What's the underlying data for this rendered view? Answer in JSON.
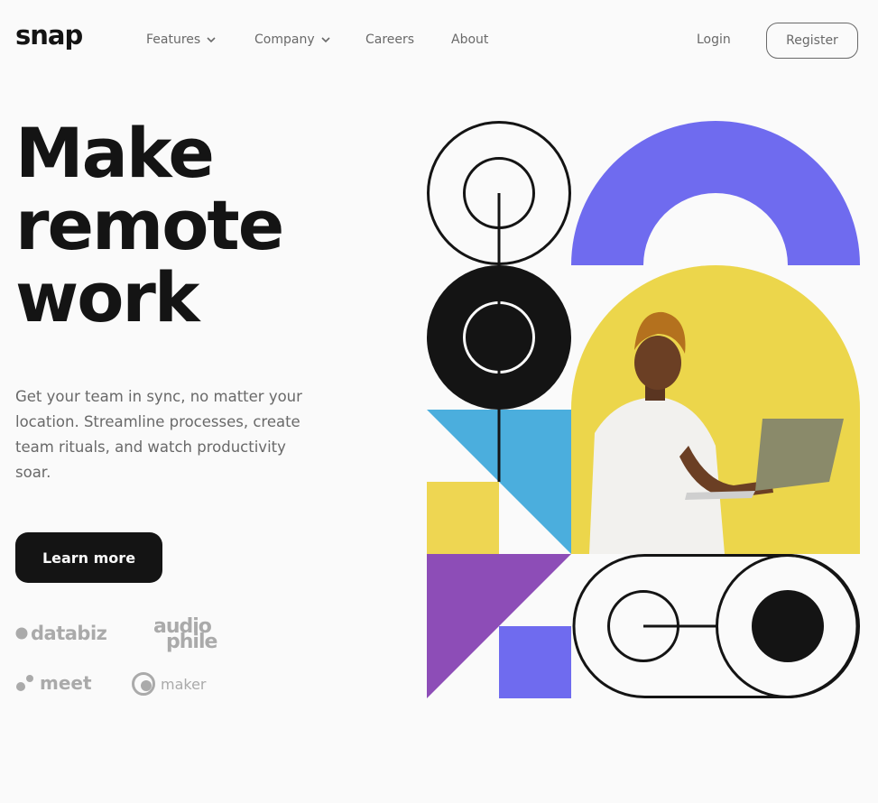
{
  "brand": {
    "logo": "snap"
  },
  "nav": {
    "features": "Features",
    "company": "Company",
    "careers": "Careers",
    "about": "About",
    "login": "Login",
    "register": "Register"
  },
  "hero": {
    "headline_lines": [
      "Make",
      "remote",
      "work"
    ],
    "description": "Get your team in sync, no matter your location. Streamline processes, create team rituals, and watch productivity soar.",
    "cta": "Learn more"
  },
  "clients": {
    "databiz": "databiz",
    "audiophile_line1": "audio",
    "audiophile_line2": "phile",
    "meet": "meet",
    "maker": "maker"
  },
  "colors": {
    "ink": "#141414",
    "muted": "#696969",
    "background": "#fafafa",
    "purple": "#6f6bef",
    "violet": "#8d4db7",
    "sky": "#4baedd",
    "yellow": "#eed652",
    "photo_yellow": "#e9d038"
  },
  "icons": {
    "features_chevron": "chevron-down-icon",
    "company_chevron": "chevron-down-icon"
  }
}
